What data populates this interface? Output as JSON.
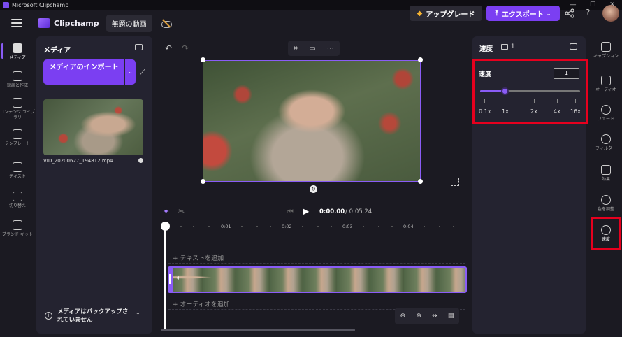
{
  "window": {
    "title": "Microsoft Clipchamp",
    "controls": [
      "—",
      "☐",
      "✕"
    ]
  },
  "header": {
    "brand": "Clipchamp",
    "project_name": "無題の動画",
    "upgrade_label": "アップグレード",
    "export_label": "エクスポート",
    "help": "?"
  },
  "left_nav": {
    "items": [
      {
        "label": "メディア",
        "icon": "folder-icon"
      },
      {
        "label": "録画と作成",
        "icon": "camera-icon"
      },
      {
        "label": "コンテンツ ライブラリ",
        "icon": "library-icon"
      },
      {
        "label": "テンプレート",
        "icon": "templates-icon"
      },
      {
        "label": "テキスト",
        "icon": "text-icon"
      },
      {
        "label": "切り替え",
        "icon": "transitions-icon"
      },
      {
        "label": "ブランド キット",
        "icon": "brand-kit-icon"
      }
    ]
  },
  "media": {
    "title": "メディア",
    "import_label": "メディアのインポート",
    "file_name": "VID_20200627_194812.mp4",
    "backup_notice": "メディアはバックアップされていません"
  },
  "playback": {
    "current": "0:00.00",
    "total": "/ 0:05.24"
  },
  "ruler": [
    "0:01",
    "0:02",
    "0:03",
    "0:04"
  ],
  "tracks": {
    "text_add": "+ テキストを追加",
    "audio_add": "+ オーディオを追加"
  },
  "speed_panel": {
    "title": "速度",
    "count": "1",
    "label": "速度",
    "value": "1",
    "slider_ticks": [
      "0.1x",
      "1x",
      "2x",
      "4x",
      "16x"
    ],
    "level_fraction": 0.24
  },
  "right_nav": {
    "items": [
      {
        "label": "キャプション",
        "icon": "captions-icon"
      },
      {
        "label": "オーディオ",
        "icon": "audio-icon"
      },
      {
        "label": "フェード",
        "icon": "fade-icon"
      },
      {
        "label": "フィルター",
        "icon": "filters-icon"
      },
      {
        "label": "効果",
        "icon": "effects-icon"
      },
      {
        "label": "色を調整",
        "icon": "color-adjust-icon"
      },
      {
        "label": "速度",
        "icon": "speed-icon"
      }
    ]
  },
  "colors": {
    "accent": "#7b3ff2",
    "highlight": "#e6001e",
    "background": "#1b1a22",
    "panel": "#242330"
  }
}
